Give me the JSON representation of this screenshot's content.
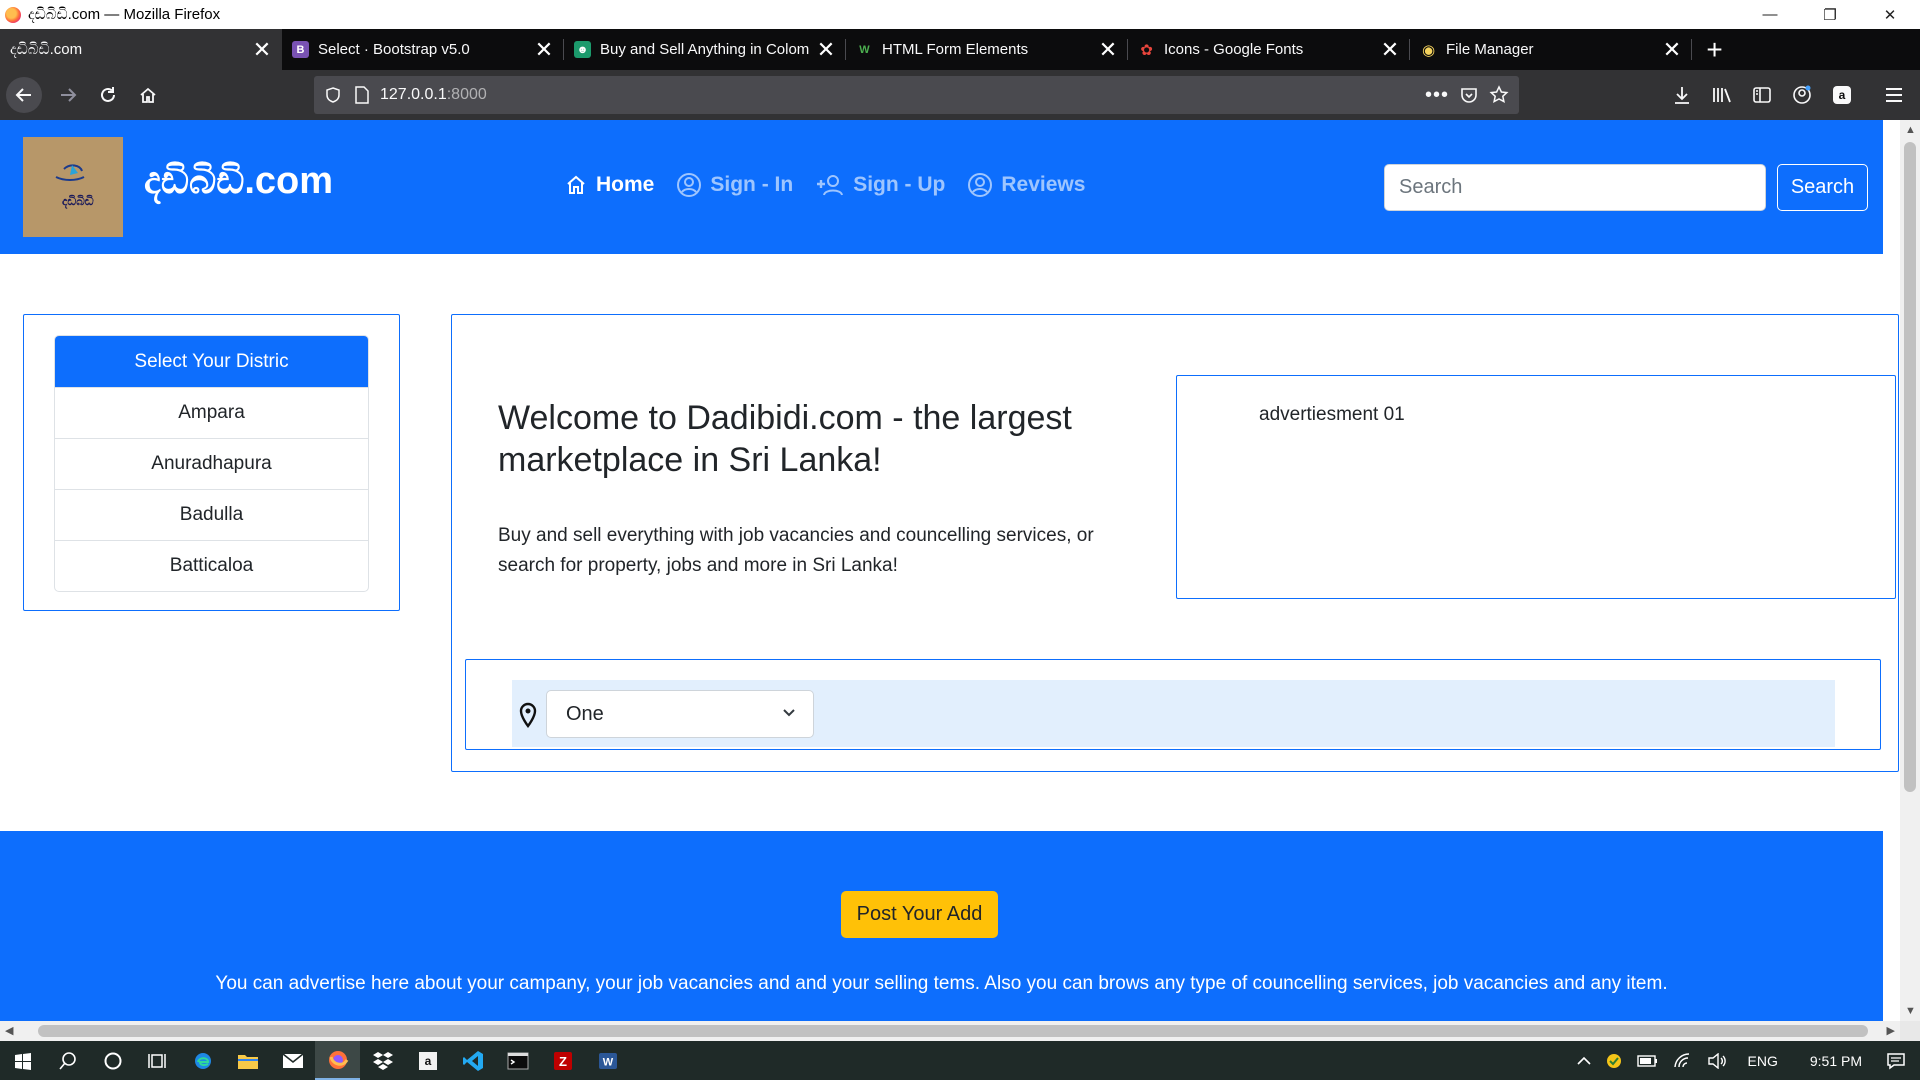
{
  "window": {
    "title": "දඩිබිඩි.com — Mozilla Firefox",
    "minimize": "—",
    "restore": "❐",
    "close": "✕"
  },
  "tabs": [
    {
      "label": "දඩිබිඩි.com",
      "favicon_color": "#3d3d40",
      "favicon_glyph": "",
      "active": true
    },
    {
      "label": "Select · Bootstrap v5.0",
      "favicon_color": "#7952b3",
      "favicon_glyph": "B",
      "active": false
    },
    {
      "label": "Buy and Sell Anything in Colom",
      "favicon_color": "#1c9a6c",
      "favicon_glyph": "☻",
      "active": false
    },
    {
      "label": "HTML Form Elements",
      "favicon_color": "#0c0c0d",
      "favicon_glyph": "W",
      "active": false
    },
    {
      "label": "Icons - Google Fonts",
      "favicon_color": "#e8453c",
      "favicon_glyph": "✿",
      "active": false
    },
    {
      "label": "File Manager",
      "favicon_color": "#f4d35e",
      "favicon_glyph": "◉",
      "active": false
    }
  ],
  "tab_close_glyph": "✕",
  "new_tab_glyph": "+",
  "urlbar": {
    "host": "127.0.0.1",
    "port": ":8000"
  },
  "site": {
    "brand": "දඩිබිඩි.com",
    "logo_text": "දඩිබිඩි",
    "nav": [
      {
        "label": "Home",
        "icon": "home-icon",
        "active": true
      },
      {
        "label": "Sign - In",
        "icon": "account-circle-icon",
        "active": false
      },
      {
        "label": "Sign - Up",
        "icon": "person-add-icon",
        "active": false
      },
      {
        "label": "Reviews",
        "icon": "account-circle-icon",
        "active": false
      }
    ],
    "search_placeholder": "Search",
    "search_button": "Search"
  },
  "districts": {
    "header": "Select Your Distric",
    "items": [
      "Ampara",
      "Anuradhapura",
      "Badulla",
      "Batticaloa"
    ]
  },
  "welcome": {
    "title": "Welcome to Dadibidi.com - the largest marketplace in Sri Lanka!",
    "text": "Buy and sell everything with job vacancies and councelling services, or search for property, jobs and more in Sri Lanka!"
  },
  "ad": {
    "text": "advertiesment 01"
  },
  "filter": {
    "selected": "One"
  },
  "footer": {
    "button": "Post Your Add",
    "text": "You can advertise here about your campany, your job vacancies and and your selling tems. Also you can brows any type of councelling services, job vacancies and any item."
  },
  "taskbar": {
    "language": "ENG",
    "time": "9:51 PM"
  },
  "colors": {
    "primary": "#0d6efd",
    "warning": "#ffc107",
    "filter_bg": "#e2effd"
  }
}
